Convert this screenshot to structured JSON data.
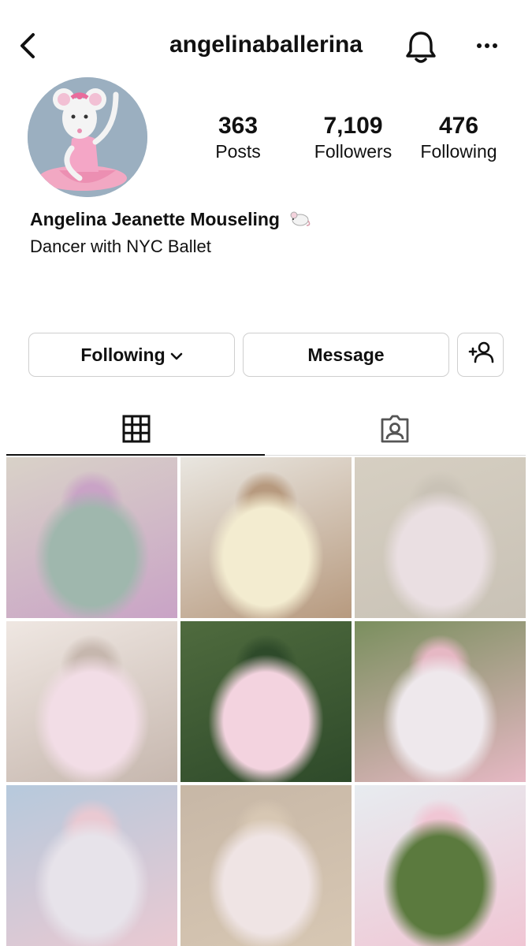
{
  "header": {
    "username": "angelinaballerina"
  },
  "profile": {
    "stats": [
      {
        "value": "363",
        "label": "Posts"
      },
      {
        "value": "7,109",
        "label": "Followers"
      },
      {
        "value": "476",
        "label": "Following"
      }
    ],
    "full_name": "Angelina Jeanette Mouseling",
    "bio": "Dancer with NYC Ballet"
  },
  "actions": {
    "following_label": "Following",
    "message_label": "Message"
  },
  "tabs": [
    {
      "icon": "grid-icon",
      "active": true
    },
    {
      "icon": "tagged-icon",
      "active": false
    }
  ],
  "posts": [
    {
      "icon": "photo",
      "colors": [
        "#d9d2c8",
        "#9fb7ad",
        "#c9a3c6"
      ]
    },
    {
      "icon": "photo",
      "colors": [
        "#e9e6e0",
        "#f3ecd0",
        "#b79a7f"
      ]
    },
    {
      "icon": "photo",
      "colors": [
        "#d6cfc2",
        "#eadfe2",
        "#c9c2b6"
      ]
    },
    {
      "icon": "photo",
      "colors": [
        "#efe7e2",
        "#f2dde6",
        "#c6b7ae"
      ]
    },
    {
      "icon": "photo",
      "colors": [
        "#4f6b3e",
        "#f3d3df",
        "#2e4a2a"
      ]
    },
    {
      "icon": "photo",
      "colors": [
        "#7a8f5e",
        "#eee8ec",
        "#e6b8c4"
      ]
    },
    {
      "icon": "photo",
      "colors": [
        "#b6c9dc",
        "#e7e3ea",
        "#e9c9d2"
      ]
    },
    {
      "icon": "photo",
      "colors": [
        "#c7b7a6",
        "#efe4e4",
        "#d7c7b3"
      ]
    },
    {
      "icon": "photo",
      "colors": [
        "#e7ecf0",
        "#5b7a3e",
        "#f0c6d4"
      ]
    }
  ],
  "colors": {
    "border": "#cfcfcf",
    "text": "#111111",
    "avatar_bg": "#9bafc0",
    "accent_pink": "#f2a8c3"
  }
}
